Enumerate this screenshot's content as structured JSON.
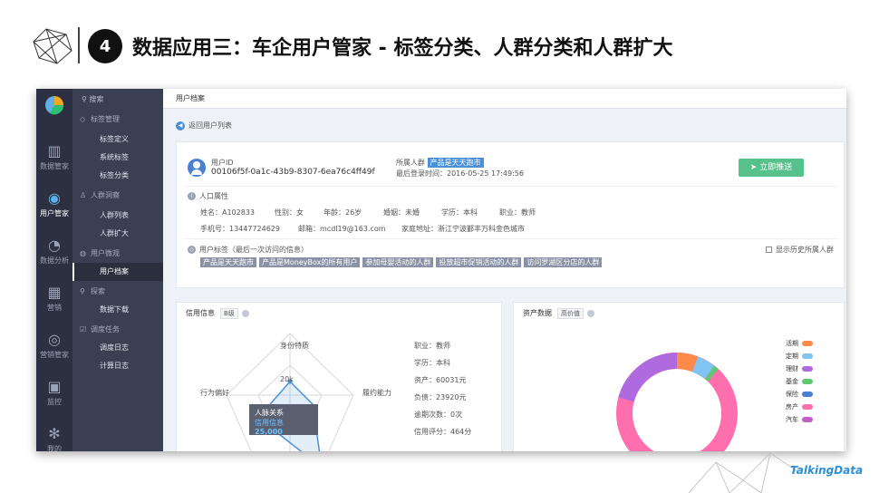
{
  "slide": {
    "number": "4",
    "title": "数据应用三：车企用户管家 - 标签分类、人群分类和人群扩大",
    "footer_brand": "TalkingData"
  },
  "nav": {
    "items": [
      {
        "label": "数据管家",
        "icon": "bar-chart-icon"
      },
      {
        "label": "用户管家",
        "icon": "user-target-icon"
      },
      {
        "label": "数据分析",
        "icon": "analysis-icon"
      },
      {
        "label": "营销",
        "icon": "bank-icon"
      },
      {
        "label": "营销管家",
        "icon": "target-icon"
      },
      {
        "label": "监控",
        "icon": "monitor-icon"
      },
      {
        "label": "我的",
        "icon": "gear-icon"
      }
    ]
  },
  "subnav": {
    "search_placeholder": "搜索",
    "groups": [
      {
        "label": "标签管理",
        "items": [
          "标签定义",
          "系统标签",
          "标签分类"
        ]
      },
      {
        "label": "人群洞察",
        "items": [
          "人群列表",
          "人群扩大"
        ]
      },
      {
        "label": "用户微观",
        "items": [
          "用户档案"
        ]
      },
      {
        "label": "探索",
        "items": [
          "数据下载"
        ]
      },
      {
        "label": "调度任务",
        "items": [
          "调度日志",
          "计算日志"
        ]
      }
    ]
  },
  "main": {
    "breadcrumb": "用户档案",
    "back_label": "返回用户列表",
    "profile": {
      "user_id_label": "用户ID",
      "user_id": "00106f5f-0a1c-43b9-8307-6ea76c4ff49f",
      "crowd_label": "所属人群",
      "crowd_tag": "产品是天天跑市",
      "last_login": "最后登录时间：2016-05-25 17:49:56",
      "push_button": "立即推送",
      "demo_title": "人口属性",
      "name": "姓名：A102833",
      "gender": "性别：女",
      "age": "年龄：26岁",
      "marriage": "婚姻：未婚",
      "education": "学历：本科",
      "job": "职业：教师",
      "phone": "手机号：13447724629",
      "email": "邮箱：mcdl19@163.com",
      "address": "家庭地址：浙江宁波鄞丰万科金色城市",
      "tags_title": "用户标签（最后一次访问的信息）",
      "tags": [
        "产品是天天跑市",
        "产品是MoneyBox的所有用户",
        "参加母婴活动的人群",
        "投放超市促销活动的人群",
        "访问罗湖区分店的人群"
      ],
      "history_label": "显示历史所属人群"
    },
    "credit": {
      "title": "信用信息",
      "grade": "B级",
      "radar_labels": [
        "身份特质",
        "履约能力",
        "行为偏好",
        "人脉关系"
      ],
      "radar_tick": "20k",
      "tooltip_title": "人脉关系",
      "tooltip_key": "信用信息",
      "tooltip_value": "25,000",
      "info": [
        "职业：教师",
        "学历：本科",
        "资产：60031元",
        "负债：23920元",
        "逾期次数：0次",
        "信用评分：464分"
      ]
    },
    "asset": {
      "title": "资产数据",
      "grade": "高价值",
      "legend": [
        {
          "label": "活期",
          "color": "#ff8a4a"
        },
        {
          "label": "定期",
          "color": "#7fc4f2"
        },
        {
          "label": "理财",
          "color": "#b06ae0"
        },
        {
          "label": "基金",
          "color": "#5fc873"
        },
        {
          "label": "保险",
          "color": "#4a7fd4"
        },
        {
          "label": "房产",
          "color": "#ff6fae"
        },
        {
          "label": "汽车",
          "color": "#c45fc9"
        }
      ]
    }
  }
}
